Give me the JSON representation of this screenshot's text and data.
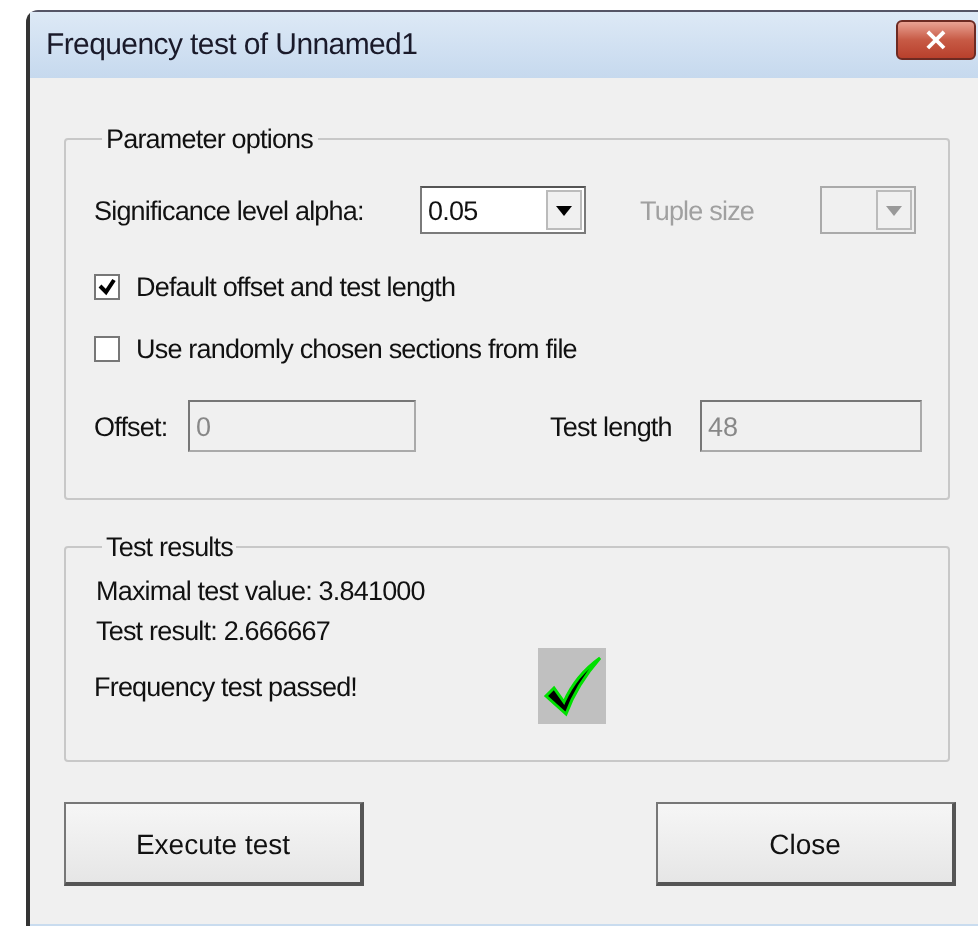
{
  "window": {
    "title": "Frequency test of Unnamed1",
    "close": "×"
  },
  "parameter_options": {
    "label": "Parameter options",
    "alpha": {
      "label": "Significance level alpha:",
      "value": "0.05",
      "disabled": false
    },
    "tuple_size": {
      "label": "Tuple size",
      "disabled": true
    },
    "checkboxes": [
      {
        "label": "Default offset and test length",
        "checked": true
      },
      {
        "label": "Use randomly chosen sections from file",
        "checked": false
      }
    ],
    "offset": {
      "label": "Offset:",
      "value": "0",
      "disabled": true
    },
    "test_length": {
      "label": "Test length",
      "value": "48",
      "disabled": true
    }
  },
  "test_results": {
    "label": "Test results",
    "lines": [
      "Maximal test value: 3.841000",
      "Test result: 2.666667"
    ],
    "message": "Frequency test passed!",
    "passed": true
  },
  "buttons": [
    {
      "label": "Execute test"
    },
    {
      "label": "Close"
    }
  ]
}
